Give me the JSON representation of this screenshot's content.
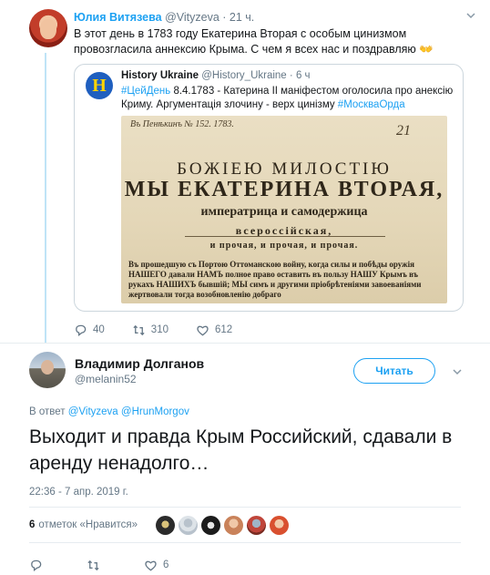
{
  "parent_tweet": {
    "author_name": "Юлия Витязева",
    "author_handle": "@Vityzeva",
    "separator": "·",
    "time": "21 ч.",
    "text": "В этот день в 1783 году Екатерина Вторая с особым цинизмом провозгласила аннексию Крыма. С чем я всех нас и поздравляю",
    "emoji": "👐",
    "quote": {
      "author_name": "History Ukraine",
      "author_handle": "@History_Ukraine",
      "separator": "·",
      "time": "6 ч",
      "hashtag1": "#ЦейДень",
      "text_middle": " 8.4.1783 - Катерина ІІ маніфестом оголосила про анексію Криму. Аргументація злочину - верх цинізму ",
      "hashtag2": "#МоскваОрда",
      "avatar_letter": "H",
      "image": {
        "top_note": "Въ Пенѣкинъ № 152. 1783.",
        "number": "21",
        "line1": "БОЖІЕЮ МИЛОСТІЮ",
        "line2": "МЫ ЕКАТЕРИНА ВТОРАЯ,",
        "line3": "императрица и самодержица",
        "line4": "всероссійская,",
        "line5": "и прочая, и прочая, и прочая.",
        "body": "Въ прошедшую съ Портою Оттоманскою войну, когда силы и побѣды оружія НАШЕГО давали НАМЪ полное право оставить въ пользу НАШУ Крымъ въ рукахъ НАШИХЪ бывшій; МЫ симъ и другими пріобрѣтеніями завоеваніями жертвовали тогда возобновленію добраго"
      }
    },
    "actions": {
      "replies": "40",
      "retweets": "310",
      "likes": "612"
    }
  },
  "reply_tweet": {
    "author_name": "Владимир Долганов",
    "author_handle": "@melanin52",
    "follow_label": "Читать",
    "replying_prefix": "В ответ",
    "replying_to_1": "@Vityzeva",
    "replying_to_2": "@HrunMorgov",
    "text": "Выходит и правда Крым Российский, сдавали в аренду ненадолго…",
    "timestamp": "22:36 - 7 апр. 2019 г.",
    "likes_count": "6",
    "likes_label": "отметок «Нравится»",
    "liker_avatars": [
      "avatar-1",
      "avatar-2",
      "avatar-3",
      "avatar-4",
      "avatar-5",
      "avatar-6"
    ],
    "actions": {
      "replies": "",
      "retweets": "",
      "likes": "6"
    }
  },
  "icons": [
    "caret-down-icon",
    "reply-icon",
    "retweet-icon",
    "like-icon"
  ],
  "colors": {
    "accent": "#1da1f2",
    "secondary_text": "#657786",
    "divider": "#e6ecf0",
    "thread_line": "#bfe4f7"
  }
}
